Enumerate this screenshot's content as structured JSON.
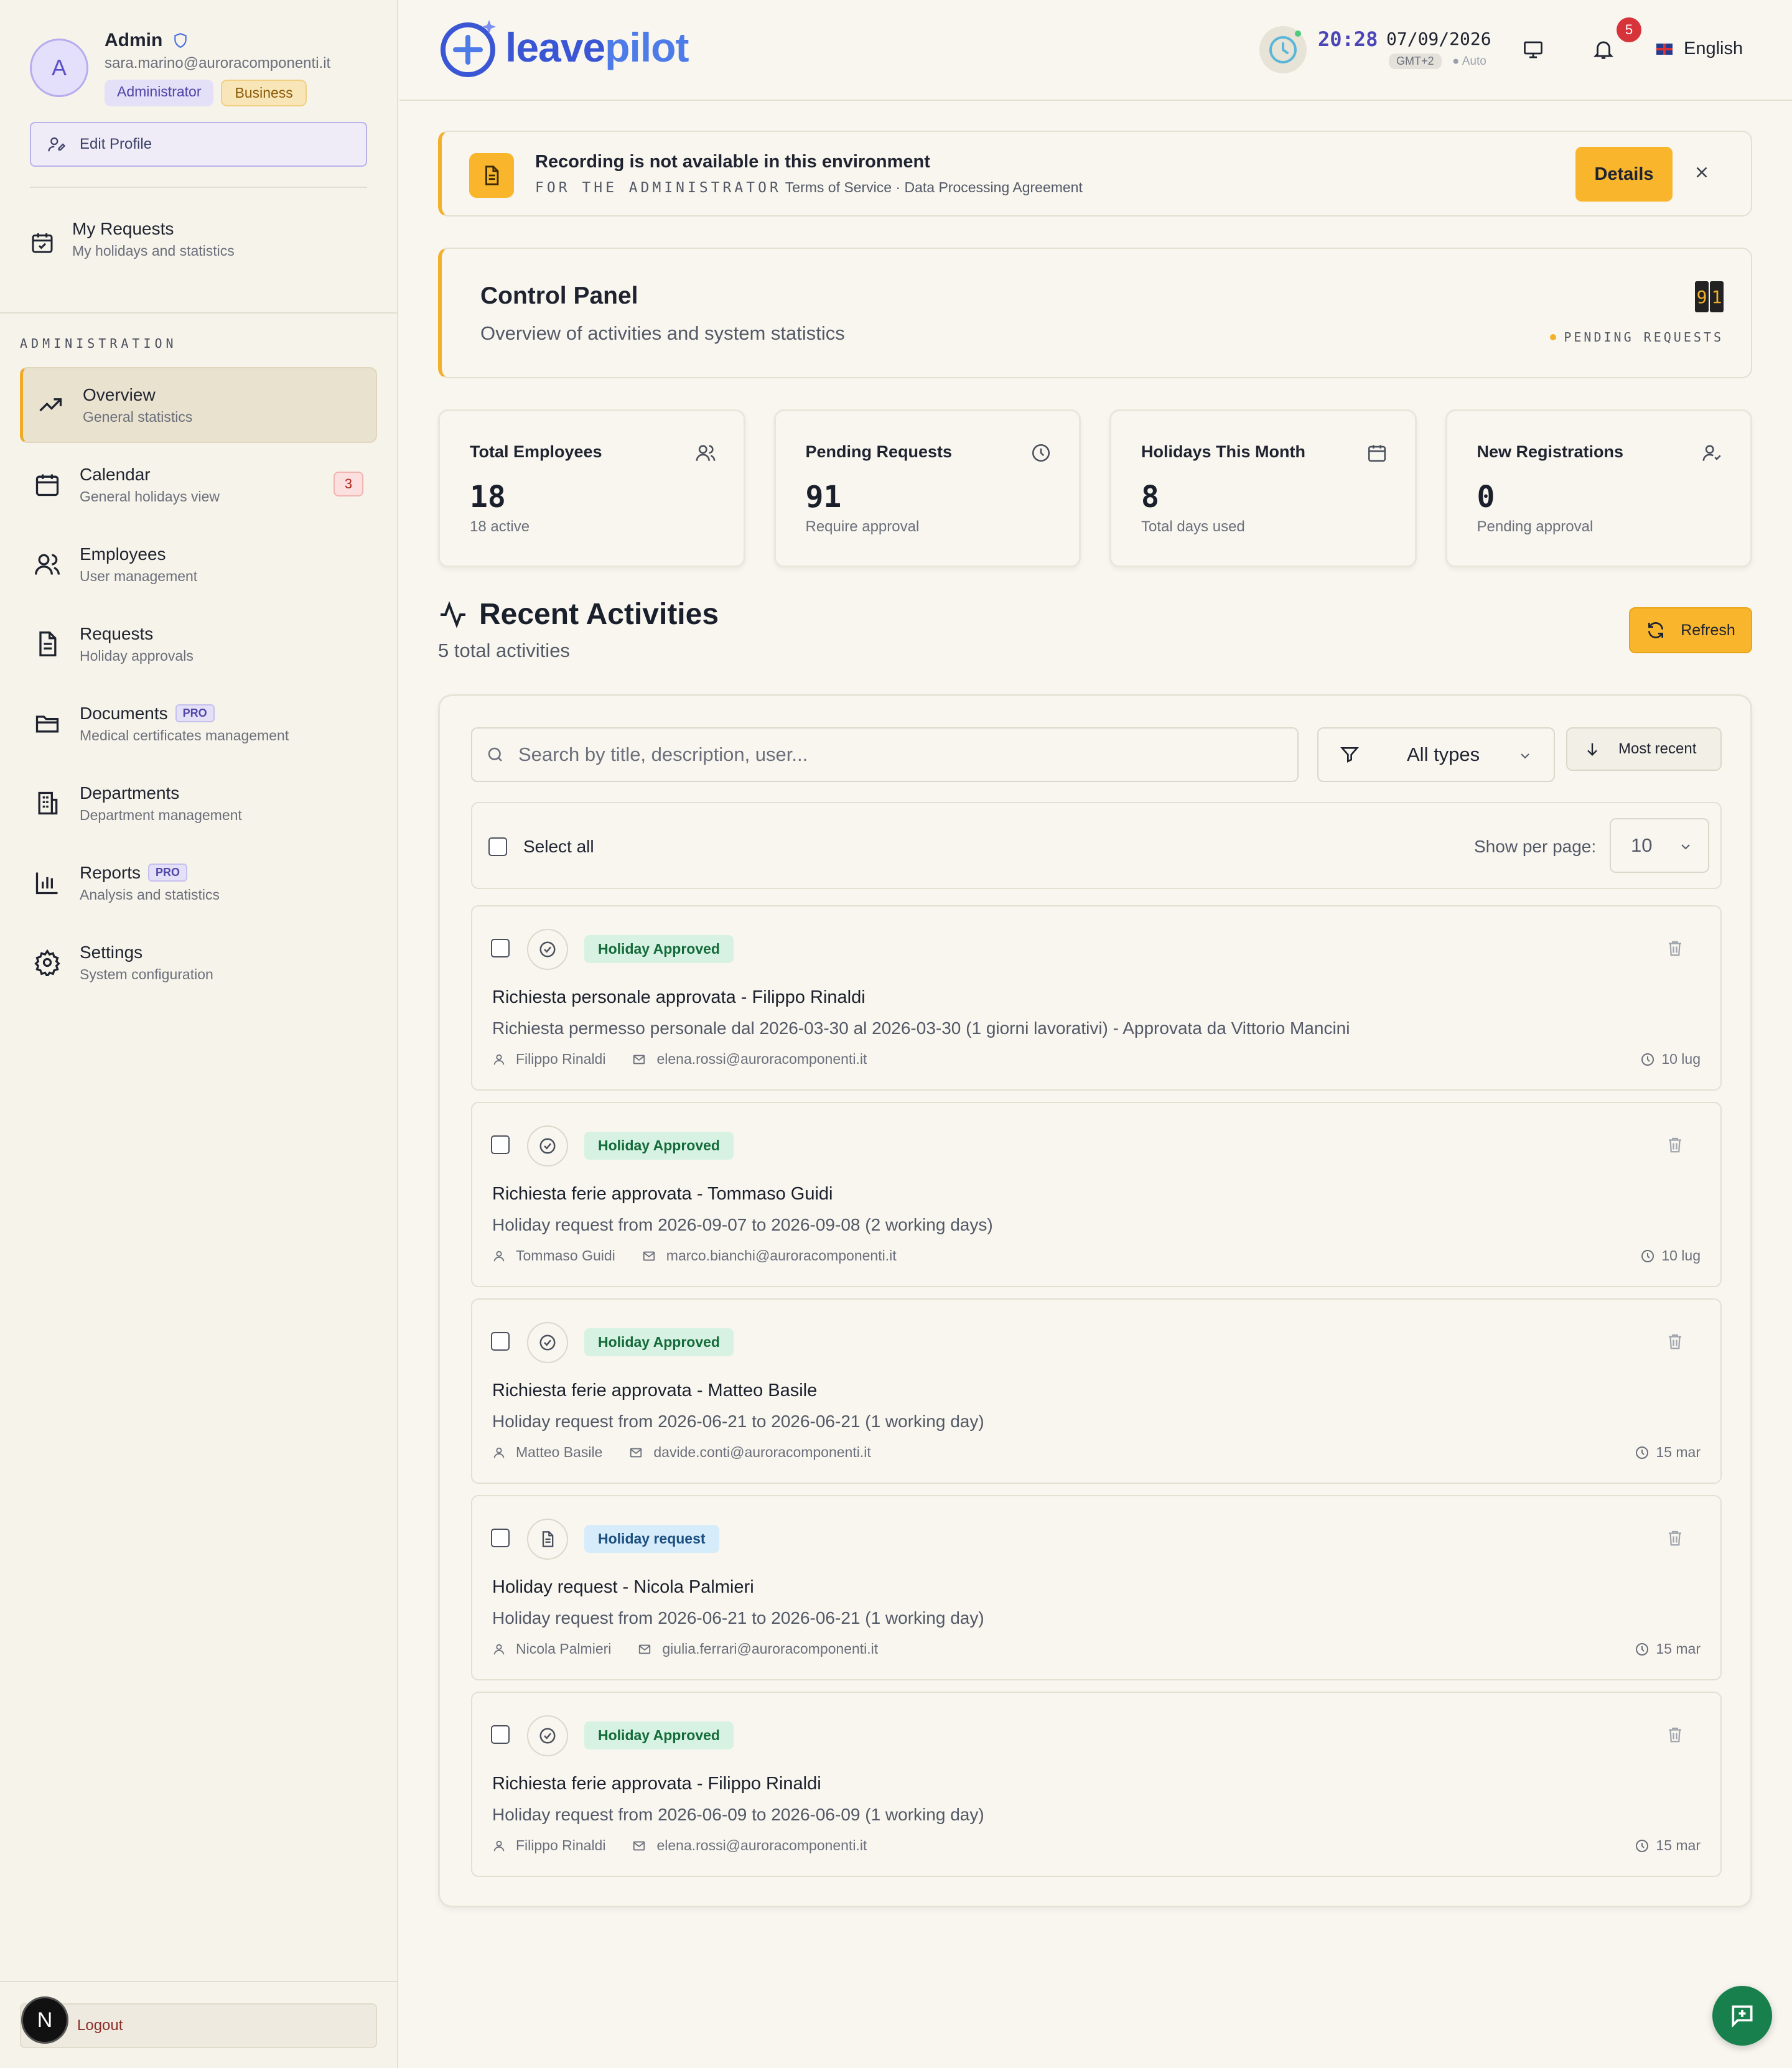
{
  "colors": {
    "accent": "#f9b52c",
    "brand_blue": "#3a56d4",
    "approved_bg": "#d7f2e3",
    "request_bg": "#d6ecfb",
    "danger": "#d6343a"
  },
  "sidebar": {
    "profile": {
      "initial": "A",
      "name": "Admin",
      "email": "sara.marino@auroracomponenti.it",
      "role_badge": "Administrator",
      "plan_badge": "Business"
    },
    "edit_profile_label": "Edit Profile",
    "my_requests": {
      "title": "My Requests",
      "subtitle": "My holidays and statistics"
    },
    "section_label": "ADMINISTRATION",
    "items": [
      {
        "title": "Overview",
        "subtitle": "General statistics",
        "icon": "trending-up-icon"
      },
      {
        "title": "Calendar",
        "subtitle": "General holidays view",
        "icon": "calendar-icon",
        "count": "3"
      },
      {
        "title": "Employees",
        "subtitle": "User management",
        "icon": "users-icon"
      },
      {
        "title": "Requests",
        "subtitle": "Holiday approvals",
        "icon": "document-icon"
      },
      {
        "title": "Documents",
        "subtitle": "Medical certificates management",
        "icon": "folder-icon",
        "badge": "PRO"
      },
      {
        "title": "Departments",
        "subtitle": "Department management",
        "icon": "building-icon"
      },
      {
        "title": "Reports",
        "subtitle": "Analysis and statistics",
        "icon": "bar-chart-icon",
        "badge": "PRO"
      },
      {
        "title": "Settings",
        "subtitle": "System configuration",
        "icon": "gear-icon"
      }
    ],
    "logout_label": "Logout",
    "dev_avatar": "N"
  },
  "header": {
    "logo_leave": "leave",
    "logo_pilot": "pilot",
    "time": "20:28",
    "date": "07/09/2026",
    "timezone": "GMT+2",
    "tz_mode": "Auto",
    "notifications": "5",
    "language": "English"
  },
  "banner": {
    "title": "Recording is not available in this environment",
    "audience": "FOR THE ADMINISTRATOR",
    "links": "Terms of Service · Data Processing Agreement",
    "details_label": "Details"
  },
  "control_panel": {
    "title": "Control Panel",
    "subtitle": "Overview of activities and system statistics",
    "flip_digits": [
      "9",
      "1"
    ],
    "pending_label": "PENDING REQUESTS"
  },
  "stats": [
    {
      "title": "Total Employees",
      "value": "18",
      "sub": "18 active",
      "icon": "users-icon"
    },
    {
      "title": "Pending Requests",
      "value": "91",
      "sub": "Require approval",
      "icon": "clock-icon"
    },
    {
      "title": "Holidays This Month",
      "value": "8",
      "sub": "Total days used",
      "icon": "calendar-icon"
    },
    {
      "title": "New Registrations",
      "value": "0",
      "sub": "Pending approval",
      "icon": "user-check-icon"
    }
  ],
  "activities": {
    "title": "Recent Activities",
    "count_label": "5 total activities",
    "refresh_label": "Refresh",
    "search_placeholder": "Search by title, description, user...",
    "type_filter": "All types",
    "sort_label": "Most recent",
    "select_all_label": "Select all",
    "per_page_label": "Show per page:",
    "per_page_value": "10",
    "items": [
      {
        "tag": "Holiday Approved",
        "tag_type": "approved",
        "title": "Richiesta personale approvata - Filippo Rinaldi",
        "description": "Richiesta permesso personale dal 2026-03-30 al 2026-03-30 (1 giorni lavorativi) - Approvata da Vittorio Mancini",
        "user": "Filippo Rinaldi",
        "email": "elena.rossi@auroracomponenti.it",
        "date": "10 lug"
      },
      {
        "tag": "Holiday Approved",
        "tag_type": "approved",
        "title": "Richiesta ferie approvata - Tommaso Guidi",
        "description": "Holiday request from 2026-09-07 to 2026-09-08 (2 working days)",
        "user": "Tommaso Guidi",
        "email": "marco.bianchi@auroracomponenti.it",
        "date": "10 lug"
      },
      {
        "tag": "Holiday Approved",
        "tag_type": "approved",
        "title": "Richiesta ferie approvata - Matteo Basile",
        "description": "Holiday request from 2026-06-21 to 2026-06-21 (1 working day)",
        "user": "Matteo Basile",
        "email": "davide.conti@auroracomponenti.it",
        "date": "15 mar"
      },
      {
        "tag": "Holiday request",
        "tag_type": "request",
        "title": "Holiday request - Nicola Palmieri",
        "description": "Holiday request from 2026-06-21 to 2026-06-21 (1 working day)",
        "user": "Nicola Palmieri",
        "email": "giulia.ferrari@auroracomponenti.it",
        "date": "15 mar"
      },
      {
        "tag": "Holiday Approved",
        "tag_type": "approved",
        "title": "Richiesta ferie approvata - Filippo Rinaldi",
        "description": "Holiday request from 2026-06-09 to 2026-06-09 (1 working day)",
        "user": "Filippo Rinaldi",
        "email": "elena.rossi@auroracomponenti.it",
        "date": "15 mar"
      }
    ]
  }
}
